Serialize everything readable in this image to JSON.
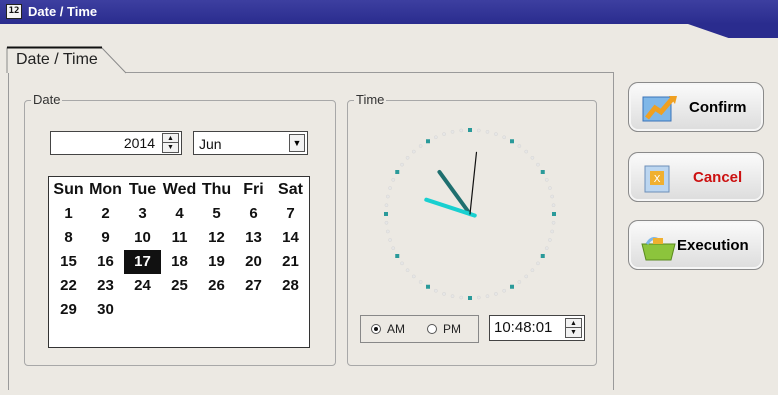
{
  "window": {
    "title": "Date / Time",
    "icon": "calendar-clock-icon"
  },
  "tab": {
    "label": "Date / Time"
  },
  "date_group": {
    "label": "Date",
    "year": "2014",
    "month": "Jun",
    "weekdays": [
      "Sun",
      "Mon",
      "Tue",
      "Wed",
      "Thu",
      "Fri",
      "Sat"
    ],
    "weeks": [
      [
        "1",
        "2",
        "3",
        "4",
        "5",
        "6",
        "7"
      ],
      [
        "8",
        "9",
        "10",
        "11",
        "12",
        "13",
        "14"
      ],
      [
        "15",
        "16",
        "17",
        "18",
        "19",
        "20",
        "21"
      ],
      [
        "22",
        "23",
        "24",
        "25",
        "26",
        "27",
        "28"
      ],
      [
        "29",
        "30",
        "",
        "",
        "",
        "",
        ""
      ]
    ],
    "selected_day": "17"
  },
  "time_group": {
    "label": "Time",
    "am_label": "AM",
    "pm_label": "PM",
    "selected_period": "AM",
    "time_value": "10:48:01",
    "clock": {
      "hour": 10,
      "minute": 48,
      "second": 1
    }
  },
  "buttons": {
    "confirm": {
      "label": "Confirm",
      "color": "#111111",
      "icon": "confirm-icon"
    },
    "cancel": {
      "label": "Cancel",
      "color": "#cc1111",
      "icon": "cancel-icon"
    },
    "execution": {
      "label": "Execution",
      "color": "#111111",
      "icon": "execution-icon"
    }
  }
}
